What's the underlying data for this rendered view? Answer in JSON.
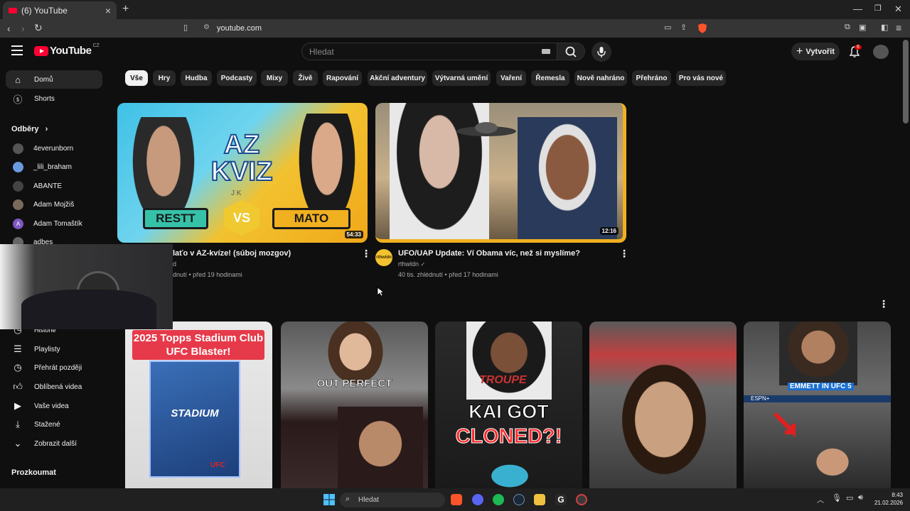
{
  "browser": {
    "tab_title": "(6) YouTube",
    "tab_close": "×",
    "new_tab": "+",
    "url": "youtube.com"
  },
  "header": {
    "logo_text": "YouTube",
    "country_code": "CZ",
    "search_placeholder": "Hledat",
    "create_label": "Vytvořit",
    "notifications_count": "6"
  },
  "sidebar": {
    "home": "Domů",
    "shorts": "Shorts",
    "subscriptions_heading": "Odběry",
    "subscriptions": [
      {
        "name": "4everunborn"
      },
      {
        "name": "_lili_braham"
      },
      {
        "name": "ABANTE"
      },
      {
        "name": "Adam Mojžiš"
      },
      {
        "name": "Adam Tomaštík",
        "initial": "A"
      },
      {
        "name": "adbes"
      }
    ],
    "history_partial": "Historie",
    "items": [
      {
        "label": "Playlisty"
      },
      {
        "label": "Přehrát později"
      },
      {
        "label": "Oblíbená videa"
      },
      {
        "label": "Vaše videa"
      },
      {
        "label": "Stažené"
      },
      {
        "label": "Zobrazit další"
      }
    ],
    "explore_heading": "Prozkoumat"
  },
  "chips": [
    "Vše",
    "Hry",
    "Hudba",
    "Podcasty",
    "Mixy",
    "Živě",
    "Rapování",
    "Akční adventury",
    "Výtvarná umění",
    "Vaření",
    "Řemesla",
    "Nově nahráno",
    "Přehráno",
    "Pro vás nové"
  ],
  "videos": [
    {
      "title": "laťo v AZ-kvíze! (súboj mozgov)",
      "channel": "d",
      "meta": "dnutí • před 19 hodinami",
      "duration": "54:33",
      "thumb_texts": {
        "big": "AZ KVIZ",
        "letters": "J K",
        "left": "RESTT",
        "vs": "VS",
        "right": "MATO"
      }
    },
    {
      "title": "UFO/UAP Update: Ví Obama víc, než si myslíme?",
      "channel": "rthwldn",
      "meta": "40 tis. zhlédnutí • před 17 hodinami",
      "duration": "12:16",
      "channel_avatar": "rthwldn"
    }
  ],
  "shorts": [
    {
      "caption": "2025 Topps Stadium Club UFC Blaster!",
      "card_text": "STADIUM",
      "brand": "UFC"
    },
    {
      "caption": "OUT PERFECT"
    },
    {
      "caption_line1": "KAI GOT",
      "caption_line2": "CLONED?!",
      "shirt_text": "TROUPE"
    },
    {
      "caption": ""
    },
    {
      "caption": "EMMETT IN UFC 5",
      "overlay_text": "ESPN+"
    }
  ],
  "taskbar": {
    "search_label": "Hledat",
    "time": "8:43",
    "date": "21.02.2026"
  },
  "colors": {
    "background": "#0f0f0f",
    "youtube_red": "#ff0033",
    "chip_bg": "#272727",
    "chip_active_bg": "#f1f1f1"
  }
}
